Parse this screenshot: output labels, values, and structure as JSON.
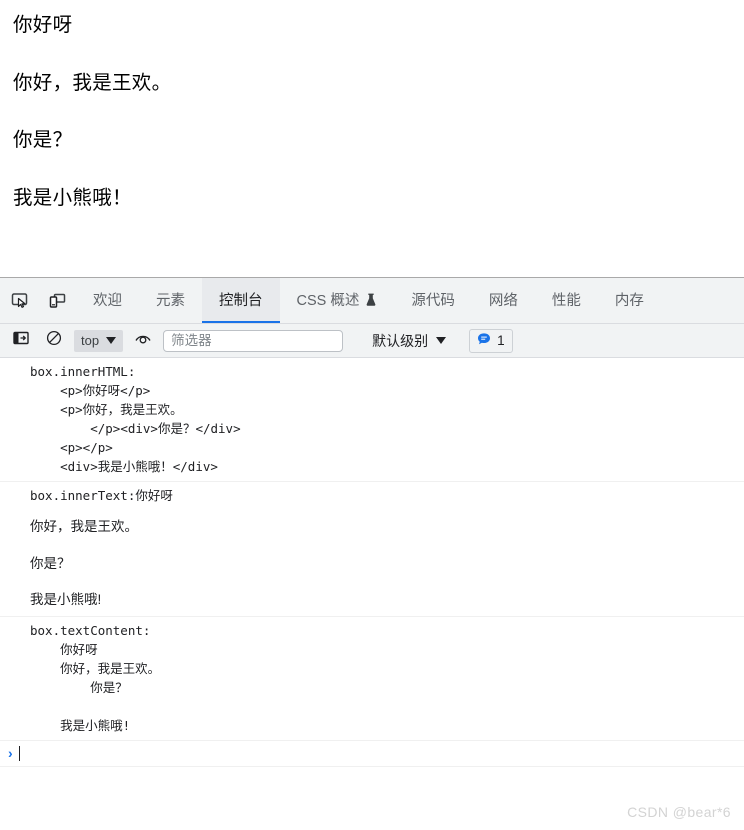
{
  "page": {
    "paragraphs": [
      "你好呀",
      "你好，我是王欢。",
      "你是？",
      "我是小熊哦！"
    ]
  },
  "devtools": {
    "icons": {
      "inspect": "inspect-element-icon",
      "device": "device-toolbar-icon"
    },
    "tabs": [
      {
        "label": "欢迎",
        "active": false,
        "experimental": false
      },
      {
        "label": "元素",
        "active": false,
        "experimental": false
      },
      {
        "label": "控制台",
        "active": true,
        "experimental": false
      },
      {
        "label": "CSS 概述",
        "active": false,
        "experimental": true
      },
      {
        "label": "源代码",
        "active": false,
        "experimental": false
      },
      {
        "label": "网络",
        "active": false,
        "experimental": false
      },
      {
        "label": "性能",
        "active": false,
        "experimental": false
      },
      {
        "label": "内存",
        "active": false,
        "experimental": false
      }
    ],
    "toolbar": {
      "sidebar_toggle_icon": "console-sidebar-icon",
      "clear_icon": "clear-console-icon",
      "context_value": "top",
      "live_expression_icon": "eye-icon",
      "filter_placeholder": "筛选器",
      "filter_value": "",
      "level_value": "默认级别",
      "message_badge_icon": "speech-bubble-icon",
      "message_badge_count": "1"
    },
    "console": {
      "messages": [
        {
          "name": "innerHTML",
          "type": "mono",
          "text": "box.innerHTML:\n    <p>你好呀</p>\n    <p>你好，我是王欢。\n        </p><div>你是？</div>\n    <p></p>\n    <div>我是小熊哦！</div>"
        },
        {
          "name": "innerText",
          "type": "innertext",
          "head": "box.innerText:你好呀",
          "lines": [
            "你好，我是王欢。",
            "你是？",
            "我是小熊哦!"
          ]
        },
        {
          "name": "textContent",
          "type": "mono",
          "text": "box.textContent:\n    你好呀\n    你好，我是王欢。\n        你是？\n\n    我是小熊哦!"
        }
      ],
      "prompt_symbol": "›"
    }
  },
  "watermark": "CSDN @bear*6",
  "colors": {
    "accent": "#1a73e8",
    "toolbar_bg": "#f1f3f4",
    "active_tab_bg": "#e8eaed",
    "text": "#202124",
    "muted_text": "#5f6368",
    "watermark": "#d3d3d3"
  }
}
